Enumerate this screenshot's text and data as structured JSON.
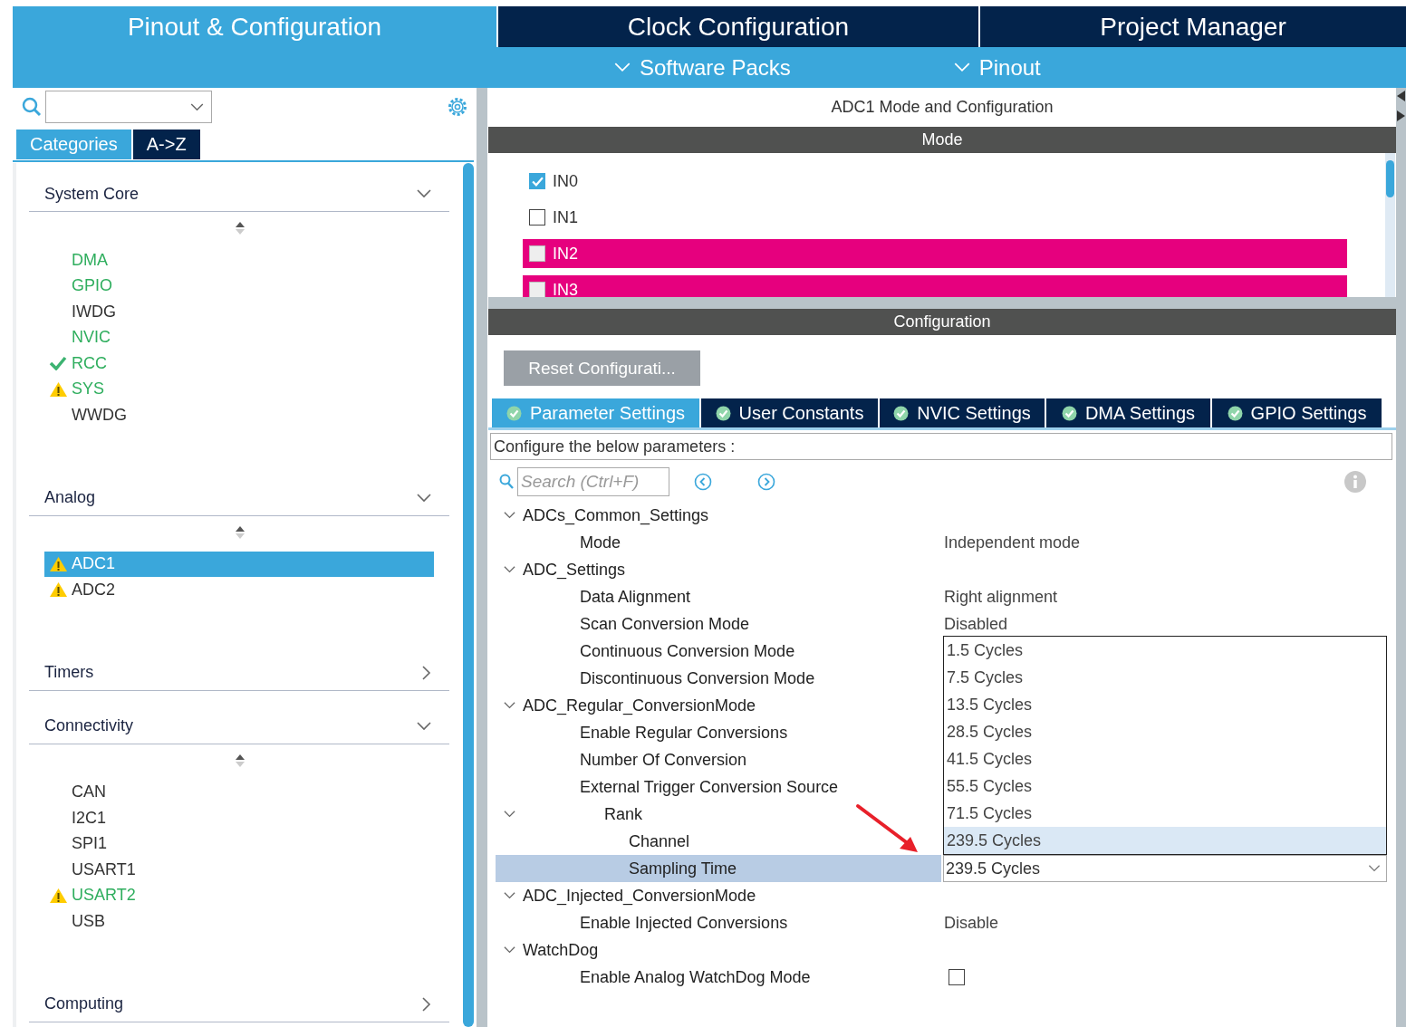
{
  "top_tabs": [
    {
      "label": "Pinout & Configuration",
      "selected": true
    },
    {
      "label": "Clock Configuration",
      "selected": false
    },
    {
      "label": "Project Manager",
      "selected": false
    }
  ],
  "sub_menu": [
    {
      "label": "Software Packs"
    },
    {
      "label": "Pinout"
    }
  ],
  "sidebar": {
    "view_tabs": [
      {
        "label": "Categories",
        "selected": true
      },
      {
        "label": "A->Z",
        "selected": false
      }
    ],
    "categories": [
      {
        "name": "System Core",
        "expanded": true,
        "items": [
          {
            "label": "DMA",
            "configured": true,
            "kind": "plain",
            "selected": false
          },
          {
            "label": "GPIO",
            "configured": true,
            "kind": "plain",
            "selected": false
          },
          {
            "label": "IWDG",
            "configured": false,
            "kind": "plain",
            "selected": false
          },
          {
            "label": "NVIC",
            "configured": true,
            "kind": "plain",
            "selected": false
          },
          {
            "label": "RCC",
            "configured": true,
            "kind": "ok",
            "selected": false
          },
          {
            "label": "SYS",
            "configured": true,
            "kind": "warning",
            "selected": false
          },
          {
            "label": "WWDG",
            "configured": false,
            "kind": "plain",
            "selected": false
          }
        ]
      },
      {
        "name": "Analog",
        "expanded": true,
        "items": [
          {
            "label": "ADC1",
            "configured": false,
            "kind": "warning",
            "selected": true
          },
          {
            "label": "ADC2",
            "configured": false,
            "kind": "warning",
            "selected": false
          }
        ]
      },
      {
        "name": "Timers",
        "expanded": false
      },
      {
        "name": "Connectivity",
        "expanded": true,
        "items": [
          {
            "label": "CAN",
            "configured": false,
            "kind": "plain",
            "selected": false
          },
          {
            "label": "I2C1",
            "configured": false,
            "kind": "plain",
            "selected": false
          },
          {
            "label": "SPI1",
            "configured": false,
            "kind": "plain",
            "selected": false
          },
          {
            "label": "USART1",
            "configured": false,
            "kind": "plain",
            "selected": false
          },
          {
            "label": "USART2",
            "configured": true,
            "kind": "warning",
            "selected": false
          },
          {
            "label": "USB",
            "configured": false,
            "kind": "plain",
            "selected": false
          }
        ]
      },
      {
        "name": "Computing",
        "expanded": false
      }
    ]
  },
  "panel": {
    "title": "ADC1 Mode and Configuration",
    "mode_header": "Mode",
    "channels": [
      {
        "label": "IN0",
        "checked": true,
        "conflict": false
      },
      {
        "label": "IN1",
        "checked": false,
        "conflict": false
      },
      {
        "label": "IN2",
        "checked": false,
        "conflict": true
      },
      {
        "label": "IN3",
        "checked": false,
        "conflict": true
      }
    ],
    "config_header": "Configuration",
    "reset_button": "Reset Configurati...",
    "config_tabs": [
      {
        "label": "Parameter Settings",
        "selected": true
      },
      {
        "label": "User Constants",
        "selected": false
      },
      {
        "label": "NVIC Settings",
        "selected": false
      },
      {
        "label": "DMA Settings",
        "selected": false
      },
      {
        "label": "GPIO Settings",
        "selected": false
      }
    ],
    "description": "Configure the below parameters :",
    "search": {
      "placeholder": "Search (Ctrl+F)"
    },
    "tree": [
      {
        "label": "ADCs_Common_Settings",
        "kind": "group",
        "expanded": true,
        "children": [
          {
            "label": "Mode",
            "kind": "text",
            "value": "Independent mode",
            "selected": false
          }
        ]
      },
      {
        "label": "ADC_Settings",
        "kind": "group",
        "expanded": true,
        "children": [
          {
            "label": "Data Alignment",
            "kind": "text",
            "value": "Right alignment",
            "selected": false
          },
          {
            "label": "Scan Conversion Mode",
            "kind": "text",
            "value": "Disabled",
            "selected": false
          },
          {
            "label": "Continuous Conversion Mode",
            "kind": "text",
            "selected": false
          },
          {
            "label": "Discontinuous Conversion Mode",
            "kind": "text",
            "selected": false
          }
        ]
      },
      {
        "label": "ADC_Regular_ConversionMode",
        "kind": "group",
        "expanded": true,
        "children": [
          {
            "label": "Enable Regular Conversions",
            "kind": "text",
            "selected": false
          },
          {
            "label": "Number Of Conversion",
            "kind": "text",
            "selected": false
          },
          {
            "label": "External Trigger Conversion Source",
            "kind": "text",
            "selected": false
          },
          {
            "label": "Rank",
            "kind": "group",
            "expanded": true,
            "children": [
              {
                "label": "Channel",
                "kind": "text",
                "selected": false
              },
              {
                "label": "Sampling Time",
                "kind": "dropdown",
                "value": "239.5 Cycles",
                "selected": true,
                "options": [
                  {
                    "label": "1.5 Cycles",
                    "selected": false
                  },
                  {
                    "label": "7.5 Cycles",
                    "selected": false
                  },
                  {
                    "label": "13.5 Cycles",
                    "selected": false
                  },
                  {
                    "label": "28.5 Cycles",
                    "selected": false
                  },
                  {
                    "label": "41.5 Cycles",
                    "selected": false
                  },
                  {
                    "label": "55.5 Cycles",
                    "selected": false
                  },
                  {
                    "label": "71.5 Cycles",
                    "selected": false
                  },
                  {
                    "label": "239.5 Cycles",
                    "selected": true
                  }
                ]
              }
            ]
          }
        ]
      },
      {
        "label": "ADC_Injected_ConversionMode",
        "kind": "group",
        "expanded": true,
        "children": [
          {
            "label": "Enable Injected Conversions",
            "kind": "text",
            "value": "Disable",
            "selected": false
          }
        ]
      },
      {
        "label": "WatchDog",
        "kind": "group",
        "expanded": true,
        "children": [
          {
            "label": "Enable Analog WatchDog Mode",
            "kind": "checkbox",
            "checked": false,
            "selected": false
          }
        ]
      }
    ]
  }
}
